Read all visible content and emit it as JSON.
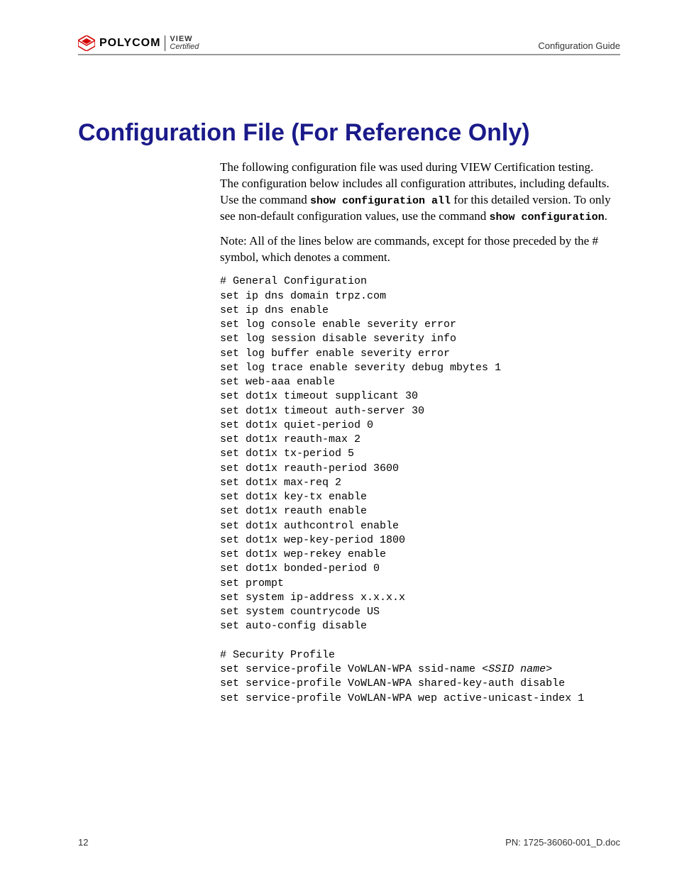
{
  "header": {
    "brand": "POLYCOM",
    "badge_top": "VIEW",
    "badge_bottom": "Certified",
    "right": "Configuration Guide"
  },
  "title": "Configuration File (For Reference Only)",
  "intro": {
    "p1_pre": "The following configuration file was used during VIEW Certification testing. The configuration below includes all configuration attributes, including defaults. Use the command ",
    "cmd1": "show configuration all",
    "p1_mid": " for this detailed version. To only see non-default configuration values, use the command ",
    "cmd2": "show configuration",
    "p1_post": ".",
    "p2": "Note: All of the lines below are commands, except for those preceded by the # symbol, which denotes a comment."
  },
  "code": {
    "block1": "# General Configuration\nset ip dns domain trpz.com\nset ip dns enable\nset log console enable severity error\nset log session disable severity info\nset log buffer enable severity error\nset log trace enable severity debug mbytes 1\nset web-aaa enable\nset dot1x timeout supplicant 30\nset dot1x timeout auth-server 30\nset dot1x quiet-period 0\nset dot1x reauth-max 2\nset dot1x tx-period 5\nset dot1x reauth-period 3600\nset dot1x max-req 2\nset dot1x key-tx enable\nset dot1x reauth enable\nset dot1x authcontrol enable\nset dot1x wep-key-period 1800\nset dot1x wep-rekey enable\nset dot1x bonded-period 0\nset prompt\nset system ip-address x.x.x.x\nset system countrycode US\nset auto-config disable\n\n# Security Profile\nset service-profile VoWLAN-WPA ssid-name ",
    "ssid_placeholder": "<SSID name>",
    "block2": "\nset service-profile VoWLAN-WPA shared-key-auth disable\nset service-profile VoWLAN-WPA wep active-unicast-index 1"
  },
  "footer": {
    "page": "12",
    "pn": "PN: 1725-36060-001_D.doc"
  }
}
